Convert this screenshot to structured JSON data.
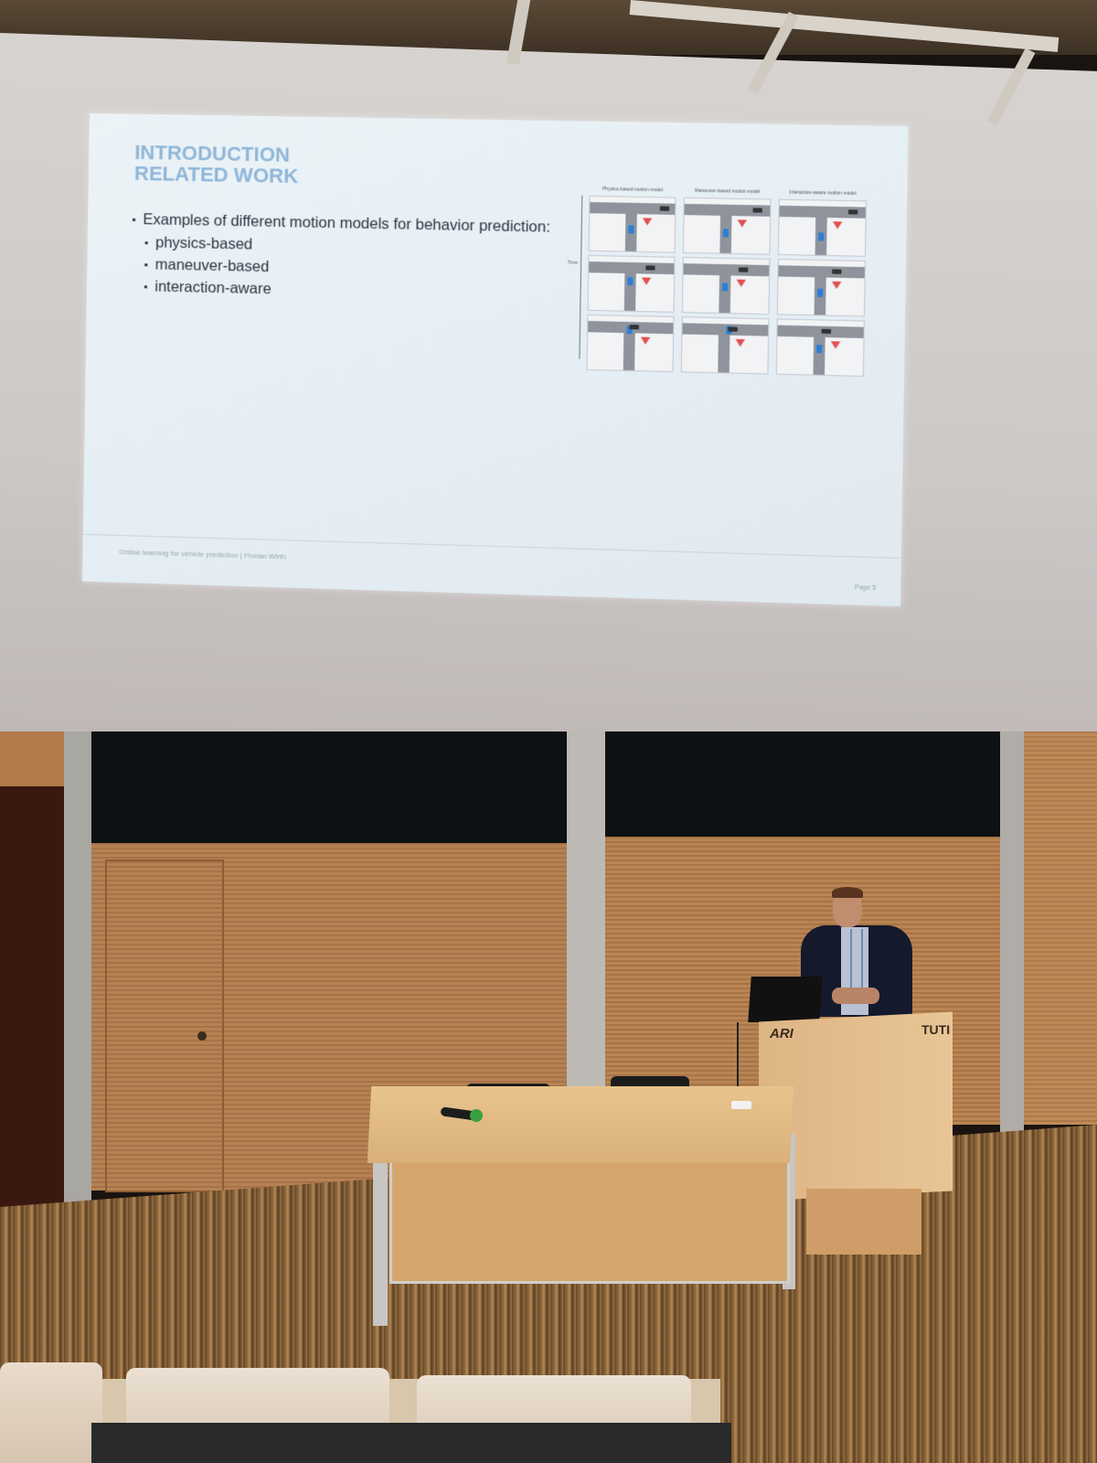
{
  "slide": {
    "title_lines": [
      "INTRODUCTION",
      "RELATED WORK"
    ],
    "bullet_main": "Examples of different motion models for behavior prediction:",
    "sub_bullets": [
      "physics-based",
      "maneuver-based",
      "interaction-aware"
    ],
    "figure": {
      "column_headers": [
        "Physics-based motion model",
        "Maneuver-based motion model",
        "Interaction-aware motion model"
      ],
      "time_label": "Time"
    },
    "footer": "Online learning for vehicle prediction | Florian Wirth",
    "page": "Page 5"
  },
  "podium": {
    "logo_left": "ARI",
    "logo_right": "TUTI"
  },
  "colors": {
    "slide_title": "#8fb6d8",
    "slide_text": "#2a3340",
    "slide_bg": "#e6eff5",
    "wood": "#b78252",
    "desk": "#e2bb84",
    "microphone_head": "#3aa040"
  }
}
